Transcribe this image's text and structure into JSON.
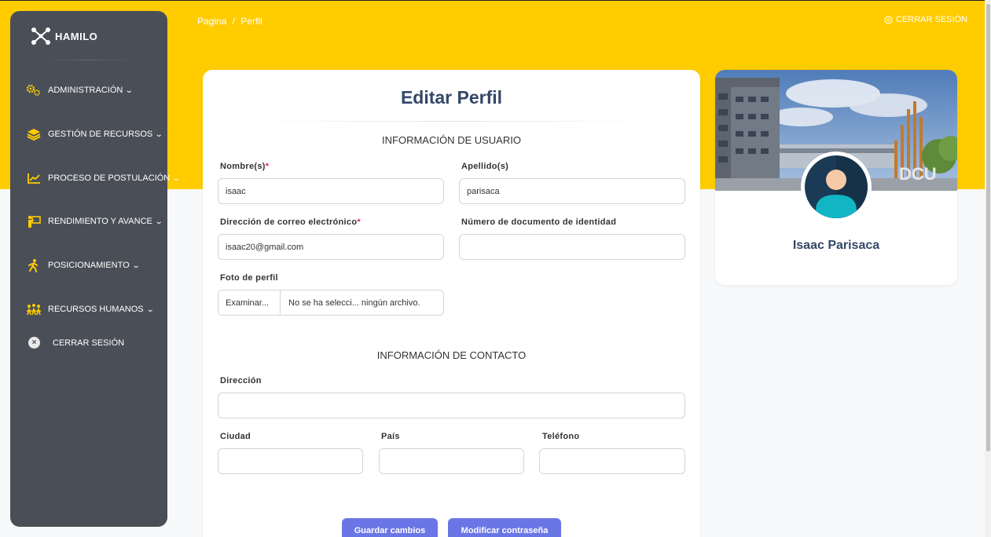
{
  "breadcrumb": {
    "root": "Pagina",
    "separator": "/",
    "current": "Perfil"
  },
  "header": {
    "logout_label": "CERRAR SESIÓN"
  },
  "sidebar": {
    "brand": "HAMILO",
    "items": [
      {
        "label": "ADMINISTRACIÓN",
        "icon": "gears-icon"
      },
      {
        "label": "GESTIÓN DE RECURSOS",
        "icon": "layers-icon"
      },
      {
        "label": "PROCESO DE POSTULACIÓN",
        "icon": "chart-line-icon"
      },
      {
        "label": "RENDIMIENTO Y AVANCE",
        "icon": "presentation-icon"
      },
      {
        "label": "POSICIONAMIENTO",
        "icon": "person-walking-icon"
      },
      {
        "label": "RECURSOS HUMANOS",
        "icon": "people-icon"
      },
      {
        "label": "CERRAR SESIÓN",
        "icon": "close-circle-icon"
      }
    ]
  },
  "form": {
    "title": "Editar Perfil",
    "user_section": "INFORMACIÓN DE USUARIO",
    "contact_section": "INFORMACIÓN DE CONTACTO",
    "nombre": {
      "label": "Nombre(s)",
      "required": "*",
      "value": "isaac"
    },
    "apellido": {
      "label": "Apellido(s)",
      "value": "parisaca"
    },
    "email": {
      "label": "Dirección de correo electrónico",
      "required": "*",
      "value": "isaac20@gmail.com"
    },
    "documento": {
      "label": "Número de documento de identidad",
      "value": ""
    },
    "foto": {
      "label": "Foto de perfil",
      "button": "Examinar...",
      "status": "No se ha selecci... ningún archivo."
    },
    "direccion": {
      "label": "Dirección",
      "value": ""
    },
    "ciudad": {
      "label": "Ciudad",
      "value": ""
    },
    "pais": {
      "label": "País",
      "value": ""
    },
    "telefono": {
      "label": "Teléfono",
      "value": ""
    },
    "save_button": "Guardar cambios",
    "password_button": "Modificar contraseña"
  },
  "profile": {
    "name": "Isaac Parisaca",
    "cover_sign": "DCU"
  },
  "colors": {
    "accent": "#ffcc00",
    "sidebar": "#4a4f57",
    "button": "#6b76e6",
    "title": "#344767"
  }
}
